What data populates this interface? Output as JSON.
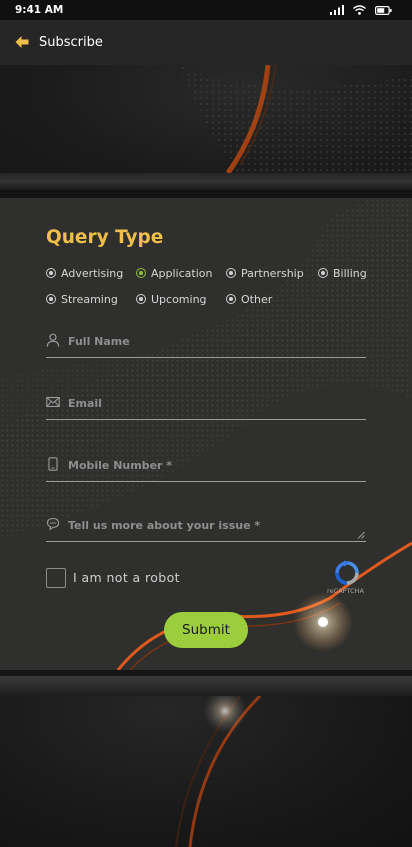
{
  "status_bar": {
    "time": "9:41 AM"
  },
  "app_bar": {
    "title": "Subscribe",
    "back_icon": "arrow-left-icon"
  },
  "form": {
    "title": "Query Type",
    "query_types": [
      {
        "label": "Advertising",
        "selected": false
      },
      {
        "label": "Application",
        "selected": true
      },
      {
        "label": "Partnership",
        "selected": false
      },
      {
        "label": "Billing",
        "selected": false
      },
      {
        "label": "Streaming",
        "selected": false
      },
      {
        "label": "Upcoming",
        "selected": false
      },
      {
        "label": "Other",
        "selected": false
      }
    ],
    "fields": {
      "full_name": {
        "placeholder": "Full Name",
        "icon": "user-icon"
      },
      "email": {
        "placeholder": "Email",
        "icon": "envelope-icon"
      },
      "mobile": {
        "placeholder": "Mobile Number *",
        "icon": "phone-icon"
      },
      "message": {
        "placeholder": "Tell us more about your issue *",
        "icon": "chat-icon"
      }
    },
    "captcha": {
      "label": "I am not a robot",
      "brand": "reCAPTCHA",
      "checked": false
    },
    "submit_label": "Submit"
  },
  "colors": {
    "accent_title": "#f0bf4a",
    "accent_green": "#9ccd3d",
    "back_arrow": "#f0bf4a",
    "swoosh": "#e05a1e"
  }
}
